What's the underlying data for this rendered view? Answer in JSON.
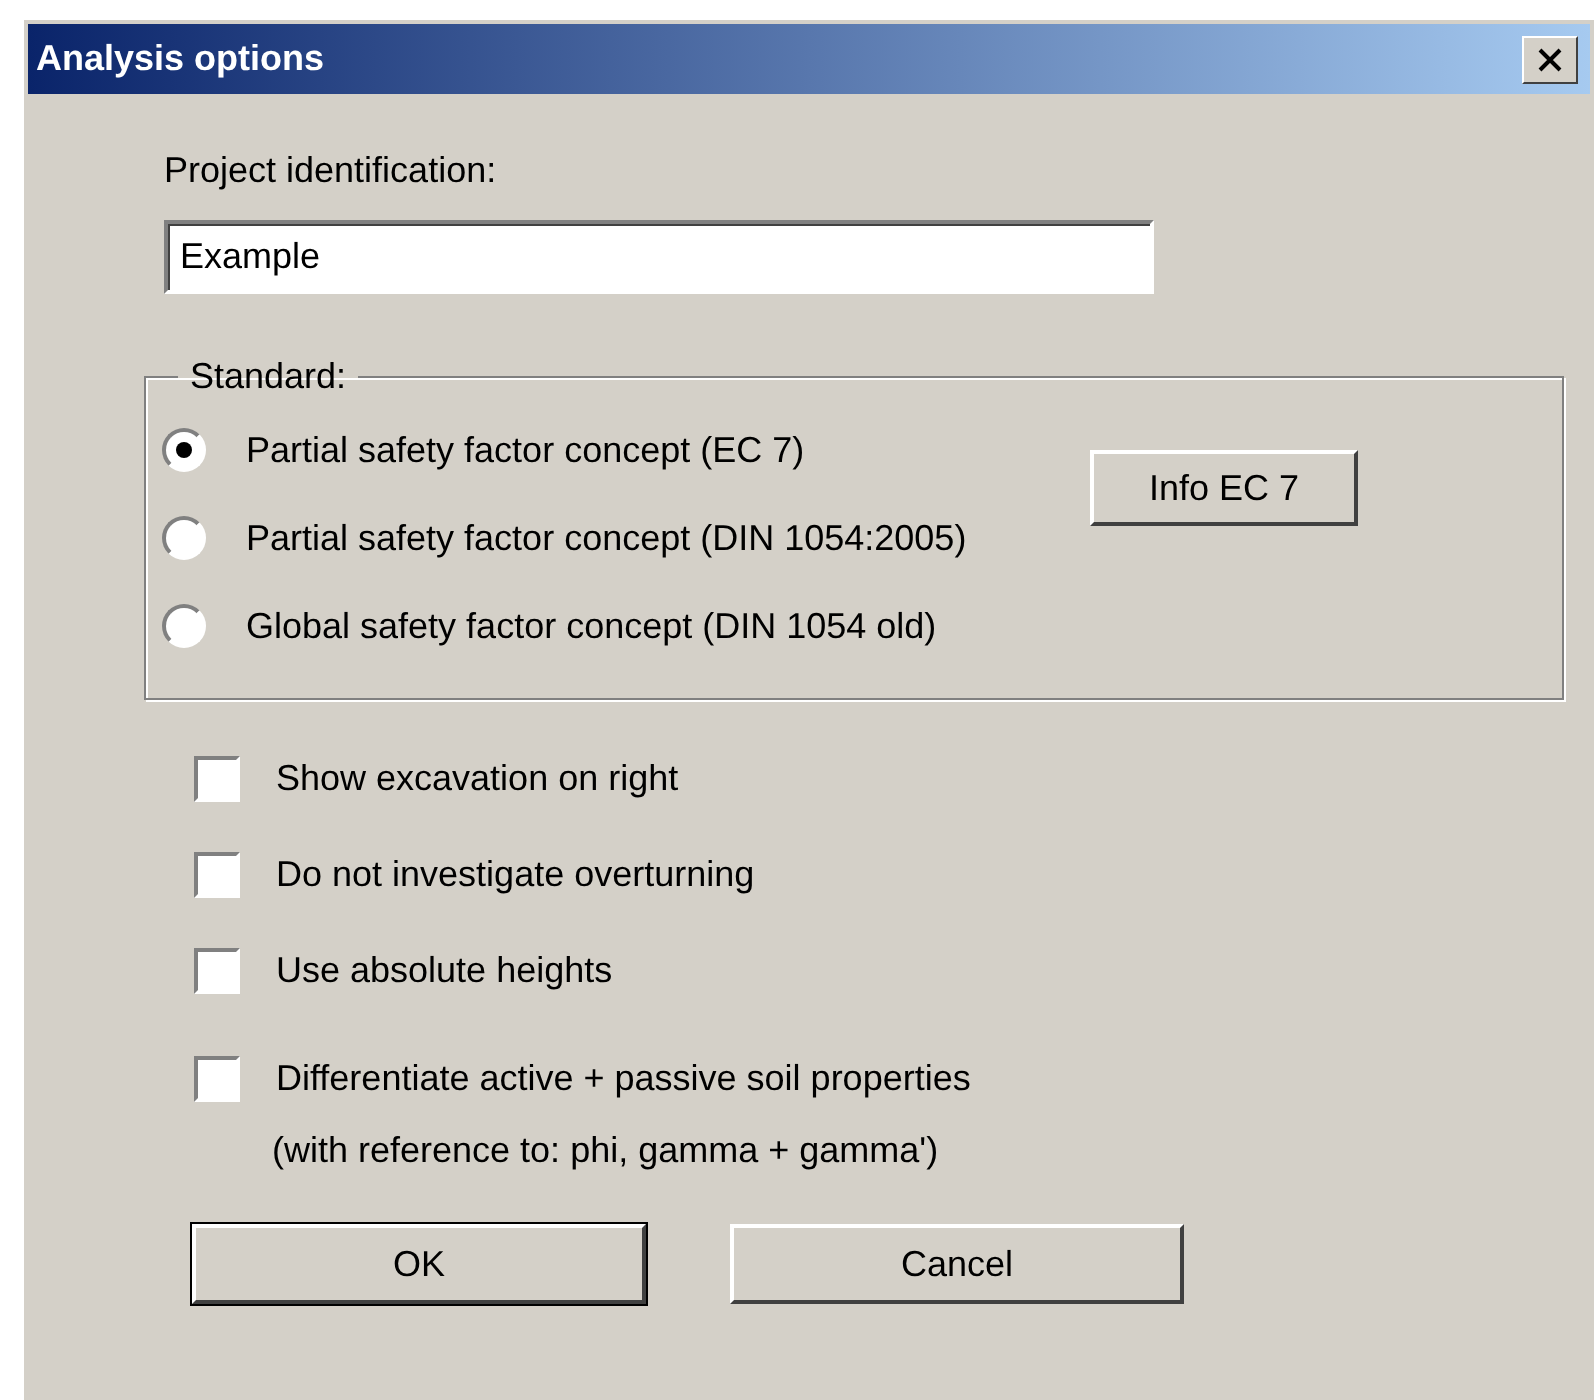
{
  "window": {
    "title": "Analysis options"
  },
  "project": {
    "label": "Project identification:",
    "value": "Example"
  },
  "standard": {
    "legend": "Standard:",
    "options": [
      {
        "label": "Partial safety factor concept (EC 7)",
        "selected": true
      },
      {
        "label": "Partial safety factor concept (DIN 1054:2005)",
        "selected": false
      },
      {
        "label": "Global safety factor concept (DIN 1054 old)",
        "selected": false
      }
    ],
    "info_button": "Info EC 7"
  },
  "checkboxes": [
    {
      "label": "Show excavation on right",
      "checked": false
    },
    {
      "label": "Do not investigate overturning",
      "checked": false
    },
    {
      "label": "Use absolute heights",
      "checked": false
    },
    {
      "label": "Differentiate active + passive soil properties",
      "checked": false
    }
  ],
  "note": "(with reference to: phi, gamma + gamma')",
  "buttons": [
    {
      "label": "OK",
      "default": true
    },
    {
      "label": "Cancel",
      "default": false
    }
  ]
}
